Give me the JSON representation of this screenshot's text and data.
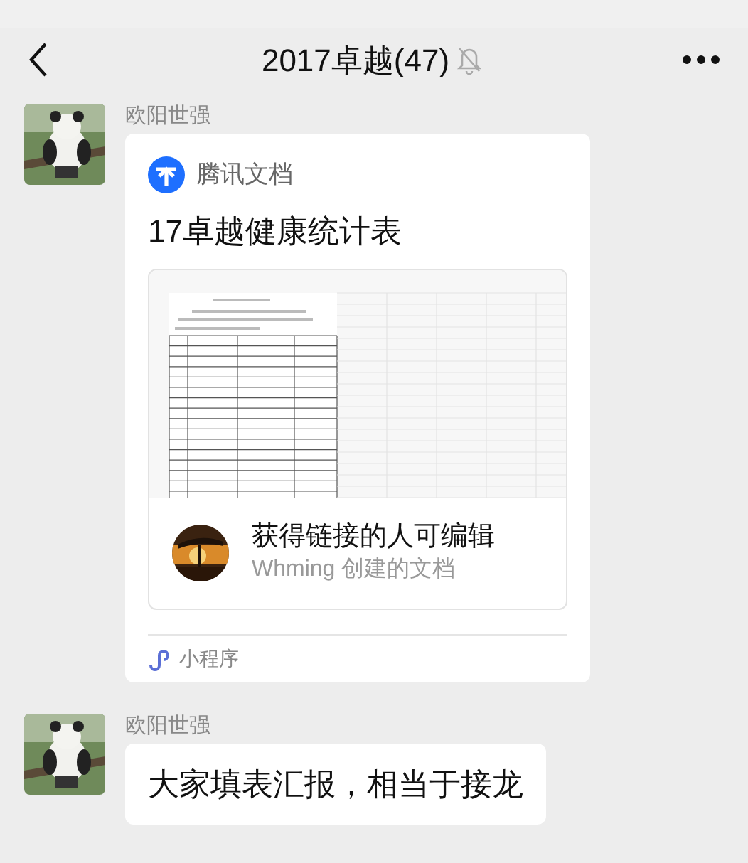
{
  "header": {
    "title": "2017卓越(47)",
    "muted": true
  },
  "messages": [
    {
      "sender": "欧阳世强",
      "kind": "card",
      "card": {
        "app": "腾讯文档",
        "title": "17卓越健康统计表",
        "permission": "获得链接的人可编辑",
        "creator": "Whming 创建的文档",
        "footer": "小程序"
      }
    },
    {
      "sender": "欧阳世强",
      "kind": "text",
      "text": "大家填表汇报，相当于接龙"
    }
  ]
}
